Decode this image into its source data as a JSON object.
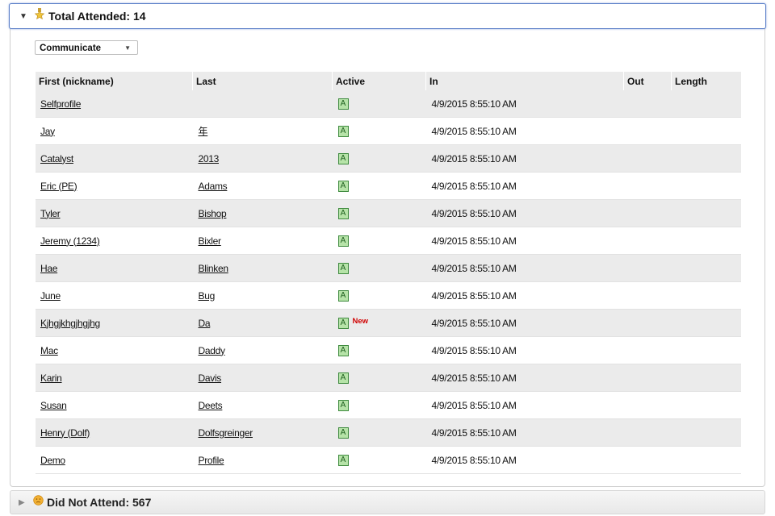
{
  "attended": {
    "title": "Total Attended: 14",
    "communicate_select": "Communicate",
    "columns": {
      "first": "First (nickname)",
      "last": "Last",
      "active": "Active",
      "in": "In",
      "out": "Out",
      "length": "Length"
    },
    "rows": [
      {
        "first": "Selfprofile",
        "last": "",
        "active": "A",
        "new": "",
        "in": "4/9/2015 8:55:10 AM"
      },
      {
        "first": "Jay",
        "last": "年",
        "active": "A",
        "new": "",
        "in": "4/9/2015 8:55:10 AM"
      },
      {
        "first": "Catalyst",
        "last": "2013",
        "active": "A",
        "new": "",
        "in": "4/9/2015 8:55:10 AM"
      },
      {
        "first": "Eric (PE)",
        "last": "Adams",
        "active": "A",
        "new": "",
        "in": "4/9/2015 8:55:10 AM"
      },
      {
        "first": "Tyler",
        "last": "Bishop",
        "active": "A",
        "new": "",
        "in": "4/9/2015 8:55:10 AM"
      },
      {
        "first": "Jeremy (1234)",
        "last": "Bixler",
        "active": "A",
        "new": "",
        "in": "4/9/2015 8:55:10 AM"
      },
      {
        "first": "Hae",
        "last": "Blinken",
        "active": "A",
        "new": "",
        "in": "4/9/2015 8:55:10 AM"
      },
      {
        "first": "June",
        "last": "Bug",
        "active": "A",
        "new": "",
        "in": "4/9/2015 8:55:10 AM"
      },
      {
        "first": "Kjhgjkhgjhgjhg",
        "last": "Da",
        "active": "A",
        "new": "New",
        "in": "4/9/2015 8:55:10 AM"
      },
      {
        "first": "Mac",
        "last": "Daddy",
        "active": "A",
        "new": "",
        "in": "4/9/2015 8:55:10 AM"
      },
      {
        "first": "Karin",
        "last": "Davis",
        "active": "A",
        "new": "",
        "in": "4/9/2015 8:55:10 AM"
      },
      {
        "first": "Susan",
        "last": "Deets",
        "active": "A",
        "new": "",
        "in": "4/9/2015 8:55:10 AM"
      },
      {
        "first": "Henry (Dolf)",
        "last": "Dolfsgreinger",
        "active": "A",
        "new": "",
        "in": "4/9/2015 8:55:10 AM"
      },
      {
        "first": "Demo",
        "last": "Profile",
        "active": "A",
        "new": "",
        "in": "4/9/2015 8:55:10 AM"
      }
    ],
    "icon": "gold-star-medal-icon"
  },
  "not_attended": {
    "title": "Did Not Attend: 567",
    "icon": "orange-sad-face-icon"
  },
  "colors": {
    "header_border": "#5b7fc8",
    "active_badge": "#b6e3a8",
    "new_badge": "#d00000",
    "row_alt": "#ebebeb"
  }
}
